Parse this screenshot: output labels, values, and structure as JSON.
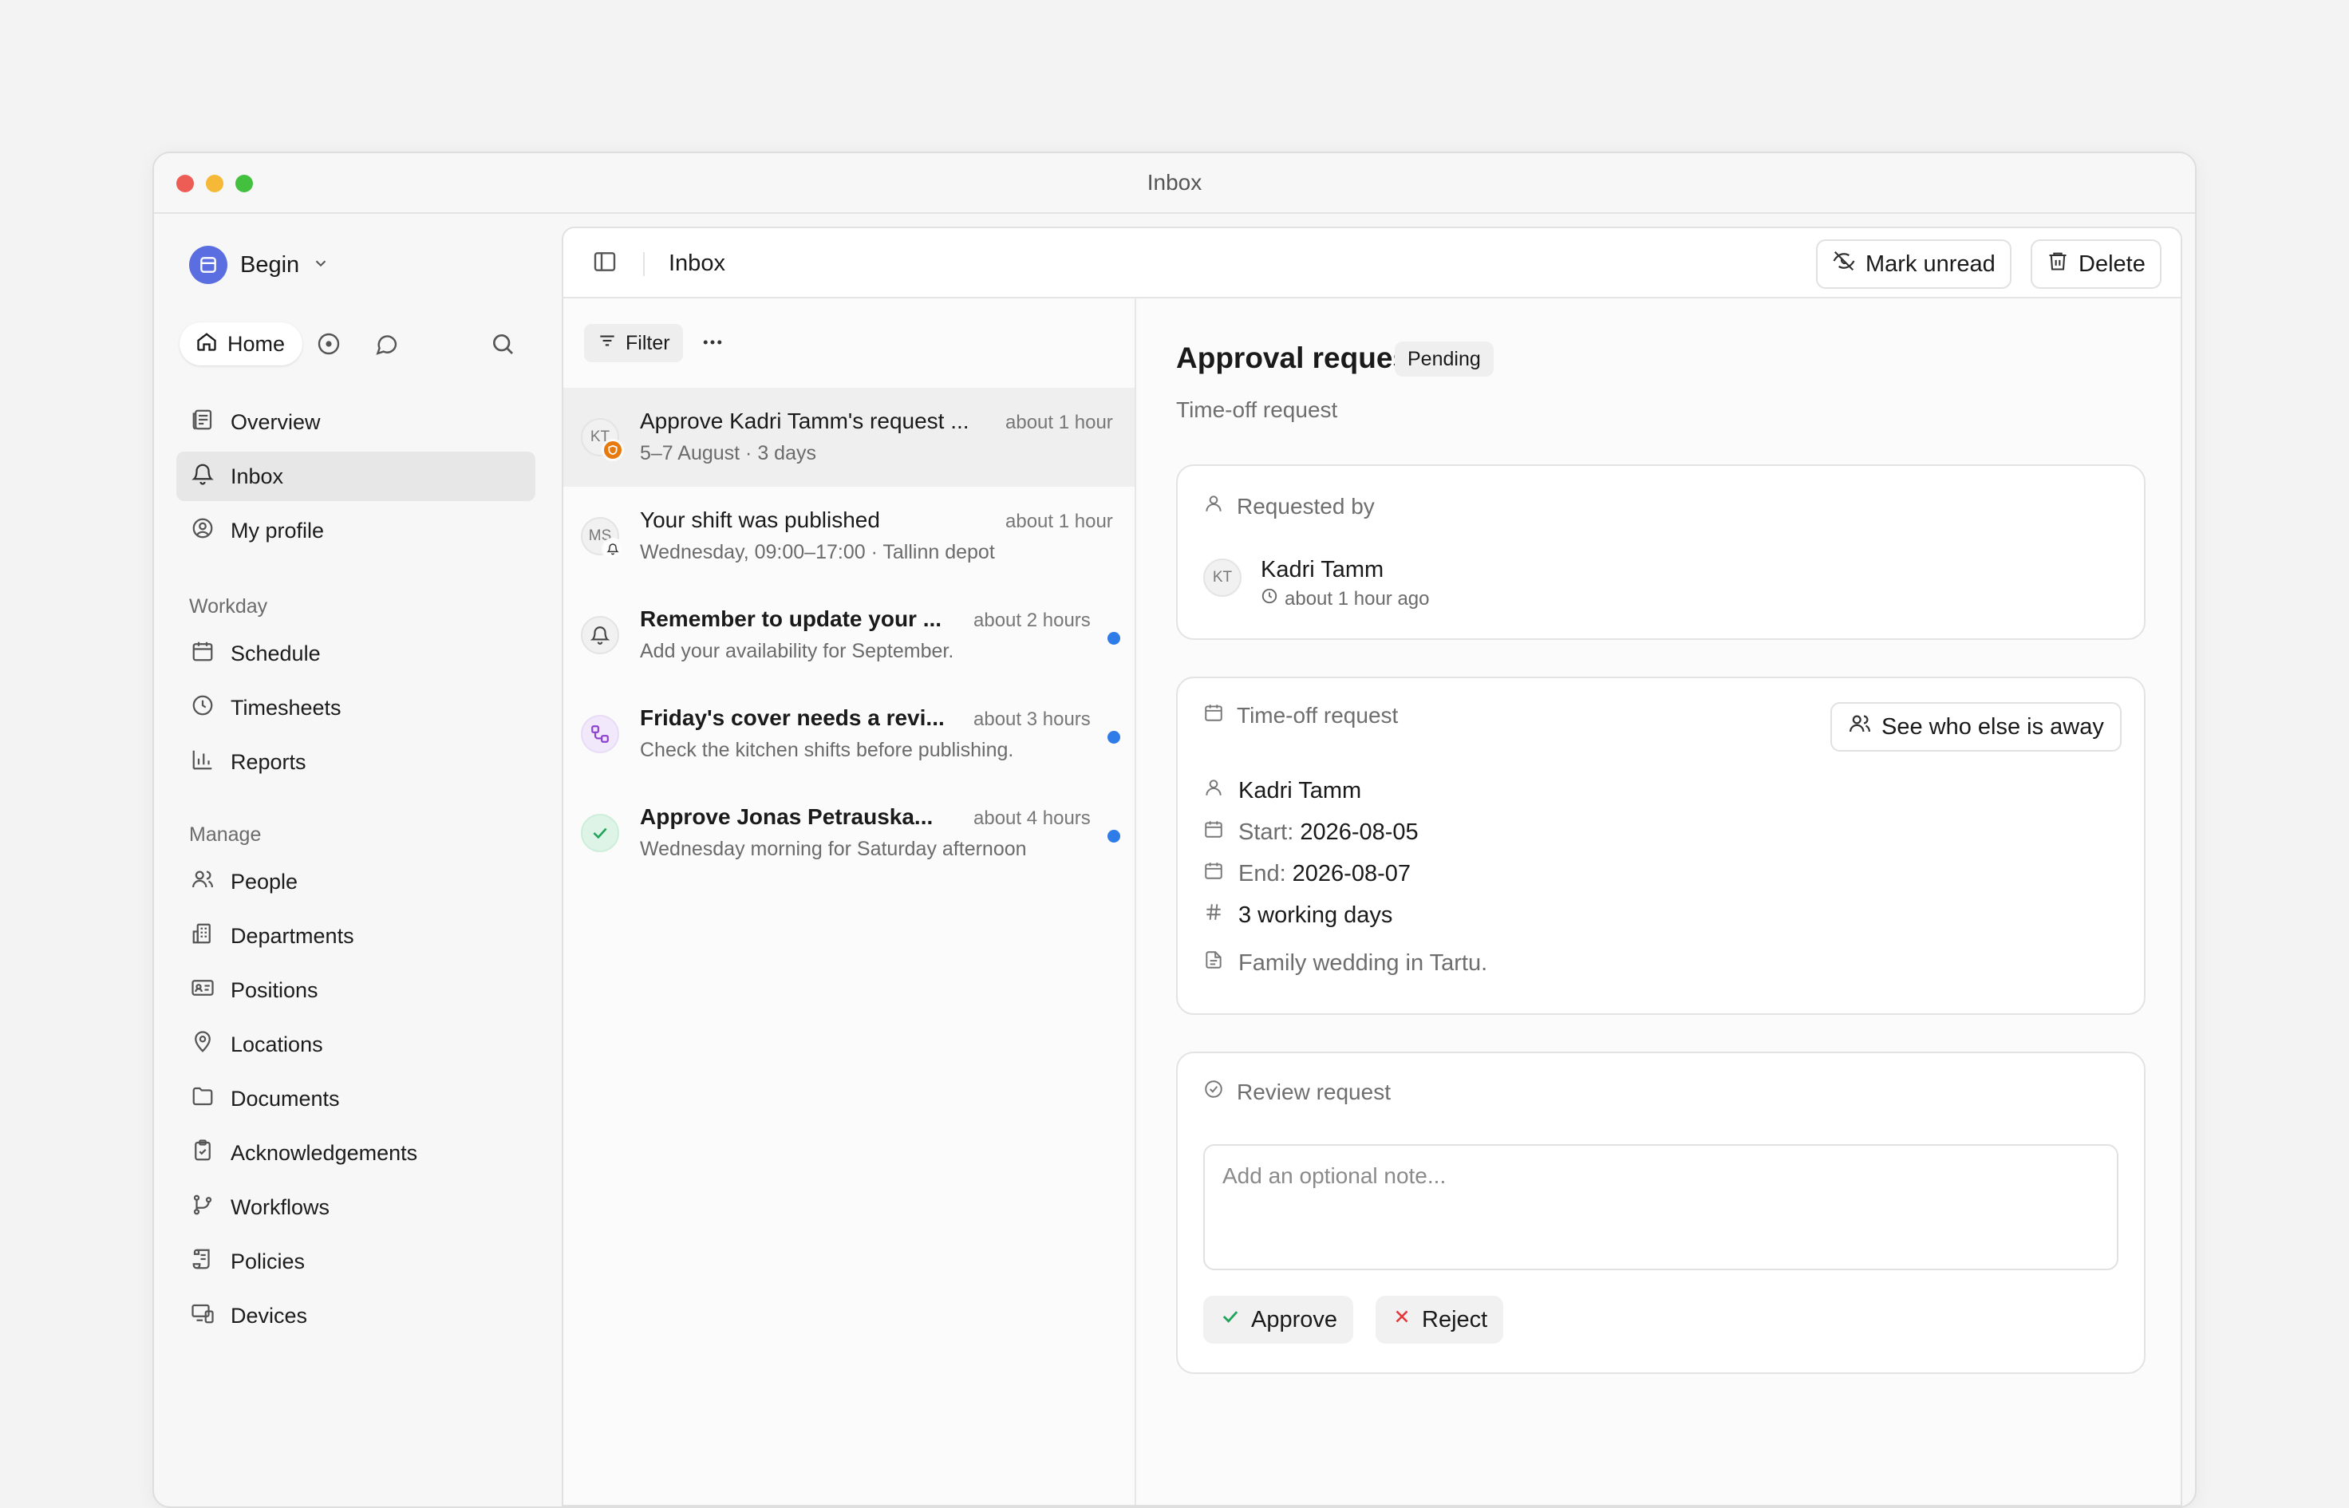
{
  "window": {
    "title": "Inbox",
    "lights": {
      "close": "#ee5d55",
      "minimize": "#f5b937",
      "zoom": "#44c03f"
    }
  },
  "sidebar": {
    "workspace": "Begin",
    "home": "Home",
    "items_top": [
      {
        "label": "Overview",
        "icon": "overview-icon"
      },
      {
        "label": "Inbox",
        "icon": "bell-icon",
        "active": true
      },
      {
        "label": "My profile",
        "icon": "user-circle-icon"
      }
    ],
    "workday_label": "Workday",
    "items_workday": [
      {
        "label": "Schedule",
        "icon": "calendar-icon"
      },
      {
        "label": "Timesheets",
        "icon": "clock-icon"
      },
      {
        "label": "Reports",
        "icon": "chart-icon"
      }
    ],
    "manage_label": "Manage",
    "items_manage": [
      {
        "label": "People",
        "icon": "people-icon"
      },
      {
        "label": "Departments",
        "icon": "building-icon"
      },
      {
        "label": "Positions",
        "icon": "id-card-icon"
      },
      {
        "label": "Locations",
        "icon": "map-pin-icon"
      },
      {
        "label": "Documents",
        "icon": "folder-icon"
      },
      {
        "label": "Acknowledgements",
        "icon": "clipboard-icon"
      },
      {
        "label": "Workflows",
        "icon": "git-branch-icon"
      },
      {
        "label": "Policies",
        "icon": "scroll-icon"
      },
      {
        "label": "Devices",
        "icon": "devices-icon"
      }
    ]
  },
  "topbar": {
    "title": "Inbox",
    "mark_unread": "Mark unread",
    "delete": "Delete"
  },
  "list": {
    "filter": "Filter",
    "items": [
      {
        "avatar": "KT",
        "title": "Approve Kadri Tamm's request ...",
        "time": "about 1 hour",
        "sub": "5–7 August · 3 days",
        "unread": false,
        "selected": true,
        "badge_color": "#e8790c"
      },
      {
        "avatar": "MS",
        "title": "Your shift was published",
        "time": "about 1 hour",
        "sub": "Wednesday, 09:00–17:00 · Tallinn depot",
        "unread": false
      },
      {
        "avatar": "",
        "title": "Remember to update your ...",
        "time": "about 2 hours",
        "sub": "Add your availability for September.",
        "unread": true
      },
      {
        "avatar": "",
        "title": "Friday's cover needs a revi...",
        "time": "about 3 hours",
        "sub": "Check the kitchen shifts before publishing.",
        "unread": true,
        "accent": "#8b3fd1"
      },
      {
        "avatar": "",
        "title": "Approve Jonas Petrauska...",
        "time": "about 4 hours",
        "sub": "Wednesday morning for Saturday afternoon",
        "unread": true,
        "accent": "#22a35a"
      }
    ]
  },
  "detail": {
    "title": "Approval request",
    "status": "Pending",
    "subtitle": "Time-off request",
    "requested_by": {
      "heading": "Requested by",
      "avatar": "KT",
      "name": "Kadri Tamm",
      "time": "about 1 hour ago"
    },
    "time_off": {
      "heading": "Time-off request",
      "see_away": "See who else is away",
      "name": "Kadri Tamm",
      "start_label": "Start:",
      "start": "2026-08-05",
      "end_label": "End:",
      "end": "2026-08-07",
      "days": "3 working days",
      "reason": "Family wedding in Tartu."
    },
    "review": {
      "heading": "Review request",
      "placeholder": "Add an optional note...",
      "approve": "Approve",
      "reject": "Reject"
    }
  }
}
